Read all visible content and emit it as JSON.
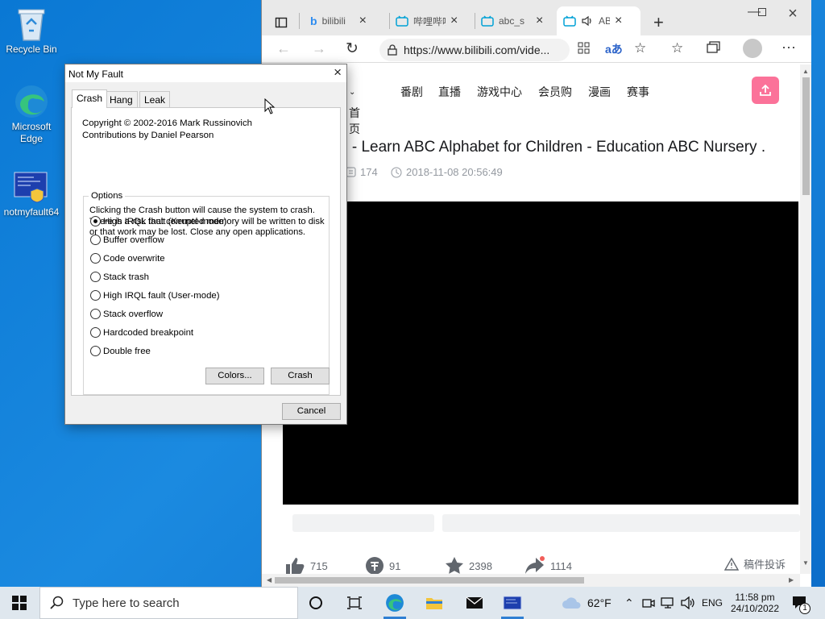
{
  "desktop": {
    "icons": [
      {
        "label": "Recycle Bin"
      },
      {
        "label": "Microsoft Edge"
      },
      {
        "label": "notmyfault64"
      }
    ]
  },
  "browser": {
    "tabs": [
      {
        "title": "bilibili"
      },
      {
        "title": "哔哩哔哩"
      },
      {
        "title": "abc_s"
      },
      {
        "title": "AB"
      }
    ],
    "url": "https://www.bilibili.com/vide...",
    "nav_items": [
      "首页",
      "番剧",
      "直播",
      "游戏中心",
      "会员购",
      "漫画",
      "赛事"
    ],
    "video_title": "g - Learn ABC Alphabet for Children - Education ABC Nursery .",
    "danmaku_count": "174",
    "publish_time": "2018-11-08 20:56:49",
    "stats": {
      "likes": "715",
      "coins": "91",
      "favorites": "2398",
      "shares": "1114",
      "report": "稿件投诉"
    }
  },
  "dialog": {
    "title": "Not My Fault",
    "tabs": [
      "Crash",
      "Hang",
      "Leak"
    ],
    "copyright_line1": "Copyright © 2002-2016 Mark Russinovich",
    "copyright_line2": "Contributions by Daniel Pearson",
    "options_label": "Options",
    "warning_line1": "Clicking the Crash button will cause the system to crash.",
    "warning_line2": "There is a risk that corrupted memory will be written to disk",
    "warning_line3": "or that work may be lost. Close any open applications.",
    "options": [
      {
        "label": "High IRQL fault (Kernel-mode)",
        "selected": true
      },
      {
        "label": "Buffer overflow",
        "selected": false
      },
      {
        "label": "Code overwrite",
        "selected": false
      },
      {
        "label": "Stack trash",
        "selected": false
      },
      {
        "label": "High IRQL fault (User-mode)",
        "selected": false
      },
      {
        "label": "Stack overflow",
        "selected": false
      },
      {
        "label": "Hardcoded breakpoint",
        "selected": false
      },
      {
        "label": "Double free",
        "selected": false
      }
    ],
    "colors_button": "Colors...",
    "crash_button": "Crash",
    "cancel_button": "Cancel"
  },
  "taskbar": {
    "search_placeholder": "Type here to search",
    "weather": "62°F",
    "language": "ENG",
    "time": "11:58 pm",
    "date": "24/10/2022",
    "notification_count": "1"
  }
}
